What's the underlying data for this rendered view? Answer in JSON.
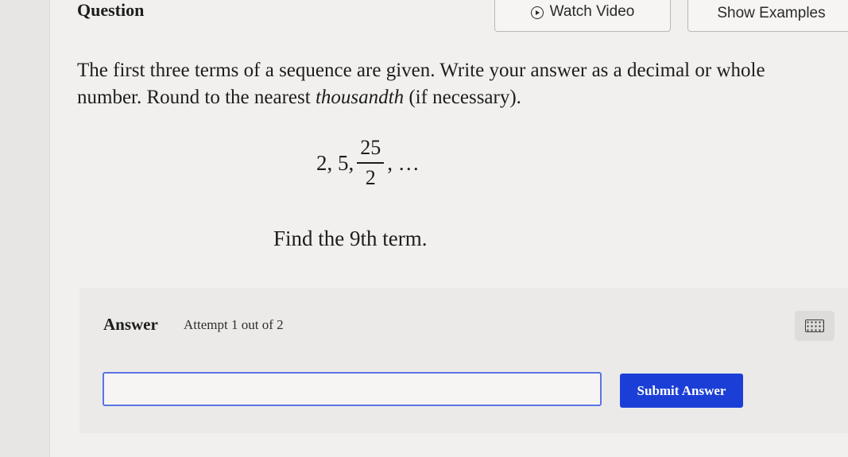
{
  "header": {
    "title": "Question",
    "watch_video_label": "Watch Video",
    "show_examples_label": "Show Examples"
  },
  "question": {
    "prompt_part1": "The first three terms of a sequence are given. Write your answer as a decimal or whole number. Round to the nearest ",
    "prompt_emphasis": "thousandth",
    "prompt_part2": " (if necessary).",
    "sequence_prefix": "2, 5,",
    "fraction_numerator": "25",
    "fraction_denominator": "2",
    "sequence_suffix": ", …",
    "find_text": "Find the 9th term."
  },
  "answer": {
    "label": "Answer",
    "attempt_text": "Attempt 1 out of 2",
    "input_value": "",
    "submit_label": "Submit Answer"
  },
  "colors": {
    "submit_button": "#1b3fd6",
    "input_border": "#5a74e6"
  },
  "icons": {
    "watch_video": "play-circle-icon",
    "keypad": "keyboard-icon"
  }
}
